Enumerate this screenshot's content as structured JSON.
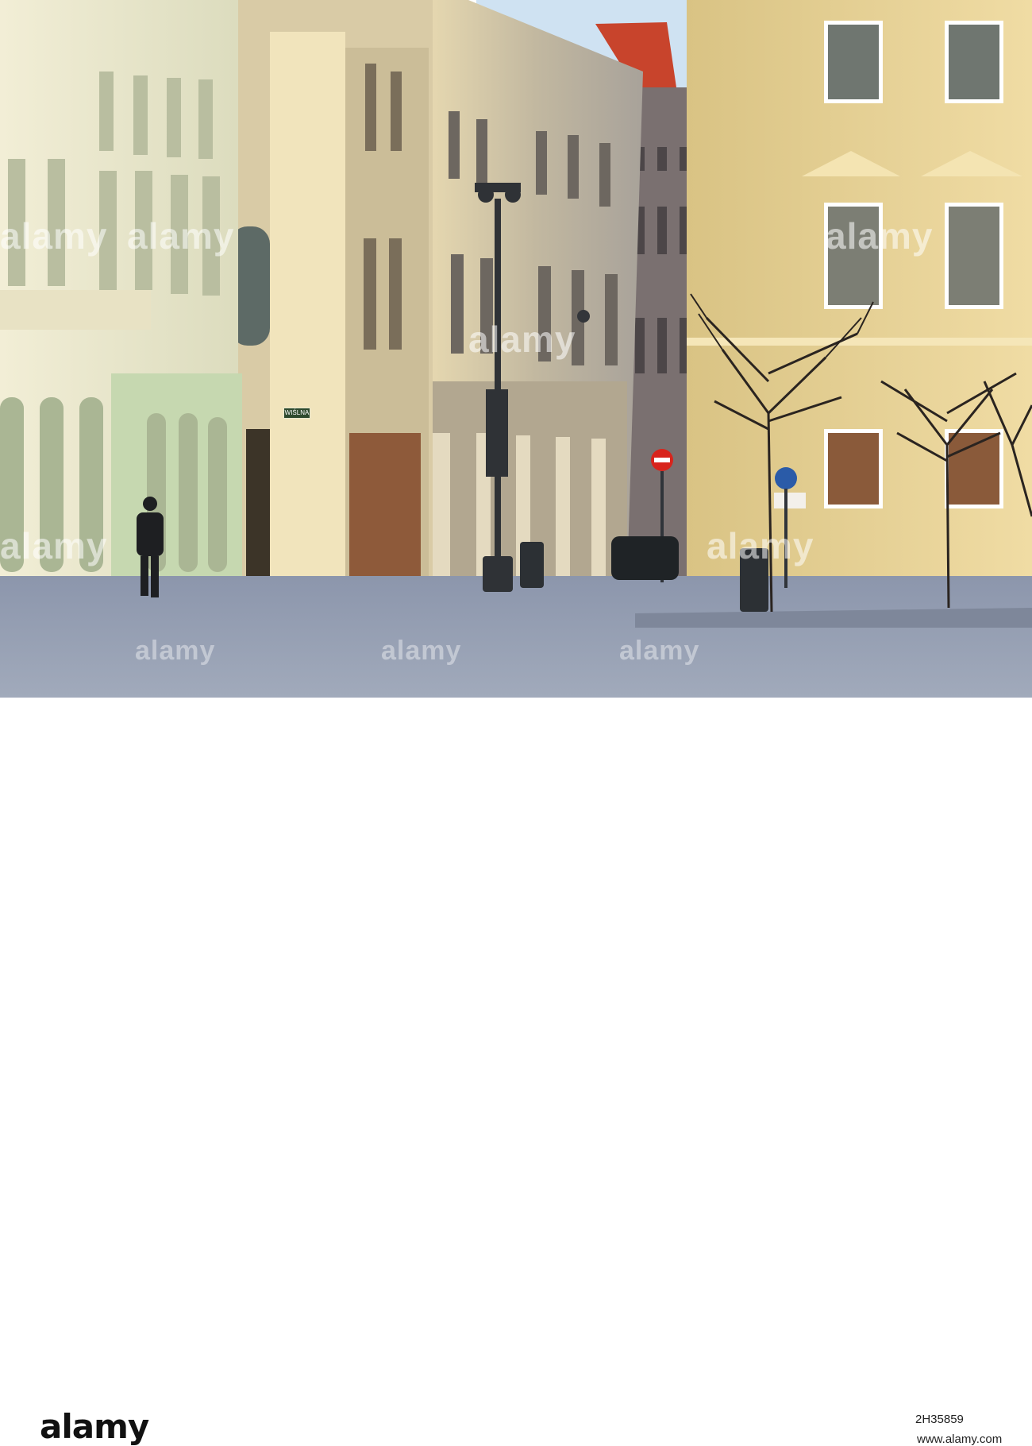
{
  "scene": {
    "street_sign": "WIŚLNA"
  },
  "watermark": {
    "text": "alamy"
  },
  "footer": {
    "brand": "alamy",
    "image_id": "2H35859",
    "site": "www.alamy.com"
  },
  "colors": {
    "sky": "#c9dff0",
    "yellow_building": "#e8d49a",
    "grey_building": "#b8b2a6",
    "pavement": "#8a93a8",
    "shadow_building": "#6e6a70",
    "roof": "#c8402a"
  }
}
